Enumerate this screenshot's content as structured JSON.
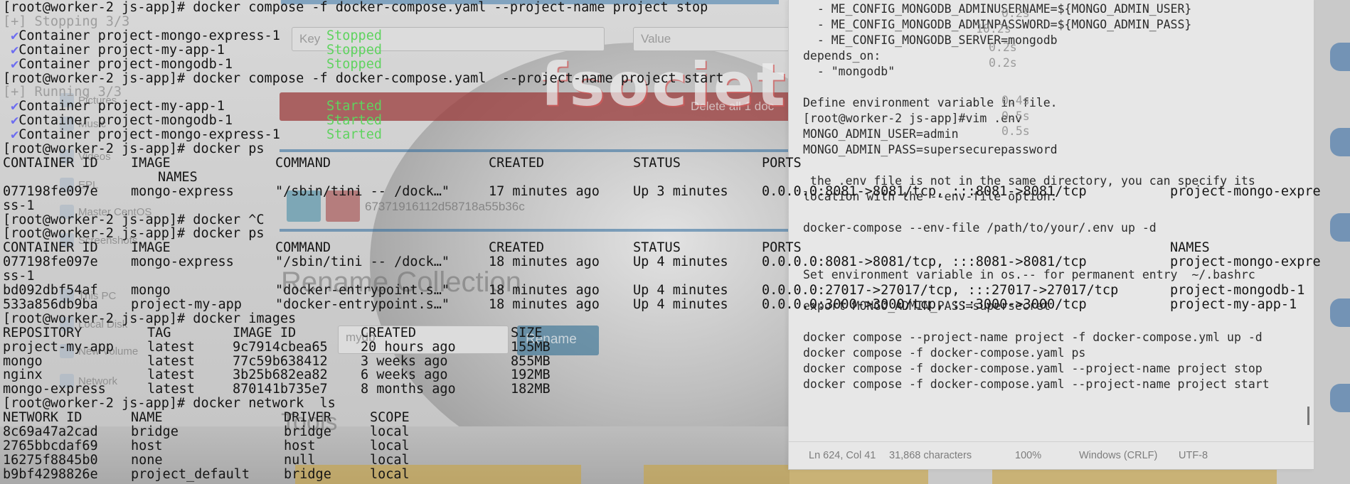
{
  "background": {
    "key_placeholder": "Key",
    "value_placeholder": "Value",
    "delete_all_label": "Delete all 1 doc",
    "document_id": "67371916112d58718a55b36c",
    "rename_title": "Rename Collection",
    "collection_input": "mydb",
    "rename_button": "Rename",
    "logo_text": "fsociety",
    "tools_title": "Tools",
    "sidebar": [
      "Pictures",
      "Music",
      "Videos",
      "EPL",
      "Master CentOS",
      "Screenshots",
      "This PC",
      "Local Disk",
      "New Volume",
      "Network"
    ]
  },
  "terminal": {
    "lines": [
      {
        "text": "[root@worker-2 js-app]# docker compose -f docker-compose.yaml --project-name project stop"
      },
      {
        "text": "[+] Stopping 3/3",
        "dim": true
      },
      {
        "check": true,
        "text": "Container project-mongo-express-1",
        "status": "Stopped"
      },
      {
        "check": true,
        "text": "Container project-my-app-1",
        "status": "Stopped"
      },
      {
        "check": true,
        "text": "Container project-mongodb-1",
        "status": "Stopped"
      },
      {
        "text": "[root@worker-2 js-app]# docker compose -f docker-compose.yaml  --project-name project start"
      },
      {
        "text": "[+] Running 3/3",
        "dim": true
      },
      {
        "check": true,
        "text": "Container project-my-app-1",
        "status": "Started"
      },
      {
        "check": true,
        "text": "Container project-mongodb-1",
        "status": "Started"
      },
      {
        "check": true,
        "text": "Container project-mongo-express-1",
        "status": "Started"
      },
      {
        "text": "[root@worker-2 js-app]# docker ps"
      }
    ],
    "ps1": {
      "headers": [
        "CONTAINER ID",
        "IMAGE",
        "COMMAND",
        "CREATED",
        "STATUS",
        "PORTS"
      ],
      "names_header": "NAMES",
      "row": [
        "077198fe097e",
        "mongo-express",
        "\"/sbin/tini -- /dock…\"",
        "17 minutes ago",
        "Up 3 minutes",
        "0.0.0.0:8081->8081/tcp, :::8081->8081/tcp",
        "project-mongo-expre"
      ],
      "wrap": "ss-1"
    },
    "ctrl_c": "[root@worker-2 js-app]# docker ^C",
    "ps_cmd": "[root@worker-2 js-app]# docker ps",
    "ps2": {
      "headers": [
        "CONTAINER ID",
        "IMAGE",
        "COMMAND",
        "CREATED",
        "STATUS",
        "PORTS",
        "NAMES"
      ],
      "rows": [
        [
          "077198fe097e",
          "mongo-express",
          "\"/sbin/tini -- /dock…\"",
          "18 minutes ago",
          "Up 4 minutes",
          "0.0.0.0:8081->8081/tcp, :::8081->8081/tcp",
          "project-mongo-expre"
        ],
        [
          "bd092dbf54af",
          "mongo",
          "\"docker-entrypoint.s…\"",
          "18 minutes ago",
          "Up 4 minutes",
          "0.0.0.0:27017->27017/tcp, :::27017->27017/tcp",
          "project-mongodb-1"
        ],
        [
          "533a856db9ba",
          "project-my-app",
          "\"docker-entrypoint.s…\"",
          "18 minutes ago",
          "Up 4 minutes",
          "0.0.0.0:3000->3000/tcp, :::3000->3000/tcp",
          "project-my-app-1"
        ]
      ],
      "wrap": "ss-1"
    },
    "images_cmd": "[root@worker-2 js-app]# docker images",
    "images": {
      "headers": [
        "REPOSITORY",
        "TAG",
        "IMAGE ID",
        "CREATED",
        "SIZE"
      ],
      "rows": [
        [
          "project-my-app",
          "latest",
          "9c7914cbea65",
          "20 hours ago",
          "155MB"
        ],
        [
          "mongo",
          "latest",
          "77c59b638412",
          "3 weeks ago",
          "855MB"
        ],
        [
          "nginx",
          "latest",
          "3b25b682ea82",
          "6 weeks ago",
          "192MB"
        ],
        [
          "mongo-express",
          "latest",
          "870141b735e7",
          "8 months ago",
          "182MB"
        ]
      ]
    },
    "network_cmd": "[root@worker-2 js-app]# docker network  ls",
    "networks": {
      "headers": [
        "NETWORK ID",
        "NAME",
        "DRIVER",
        "SCOPE"
      ],
      "rows": [
        [
          "8c69a47a2cad",
          "bridge",
          "bridge",
          "local"
        ],
        [
          "2765bbcdaf69",
          "host",
          "host",
          "local"
        ],
        [
          "16275f8845b0",
          "none",
          "null",
          "local"
        ],
        [
          "b9bf4298826e",
          "project_default",
          "bridge",
          "local"
        ]
      ]
    }
  },
  "notepad": {
    "lines": [
      "  - ME_CONFIG_MONGODB_ADMINUSERNAME=${MONGO_ADMIN_USER}",
      "  - ME_CONFIG_MONGODB_ADMINPASSWORD=${MONGO_ADMIN_PASS}",
      "  - ME_CONFIG_MONGODB_SERVER=mongodb",
      "depends_on:",
      "  - \"mongodb\"",
      "",
      "Define environment variable in file.",
      "[root@worker-2 js-app]#vim .env",
      "MONGO_ADMIN_USER=admin",
      "MONGO_ADMIN_PASS=supersecurepassword",
      "",
      " the .env file is not in the same directory, you can specify its",
      "location with the --env-file option:",
      "",
      "docker-compose --env-file /path/to/your/.env up -d",
      "",
      "",
      "Set environment variable in os.-- for permanent entry  ~/.bashrc",
      "",
      "export MONGO_ADMIN_PASS=supersecret",
      "",
      "docker compose --project-name project -f docker-compose.yml up -d",
      "docker compose -f docker-compose.yaml ps",
      "docker compose -f docker-compose.yaml --project-name project stop",
      "docker compose -f docker-compose.yaml --project-name project start"
    ],
    "ghost_timings": [
      "0.2s",
      "10.2s",
      "0.2s",
      "0.2s",
      "0.4s",
      "0.5s",
      "0.5s"
    ],
    "ghost_names_tail": "ct-my-app-1",
    "status": {
      "position": "Ln 624, Col 41",
      "chars": "31,868 characters",
      "zoom": "100%",
      "eol": "Windows (CRLF)",
      "encoding": "UTF-8"
    }
  },
  "colors": {
    "terminal_text": "#151515",
    "green": "#5fd35f",
    "check": "#6d6df0",
    "dim": "#9d9d9d"
  }
}
